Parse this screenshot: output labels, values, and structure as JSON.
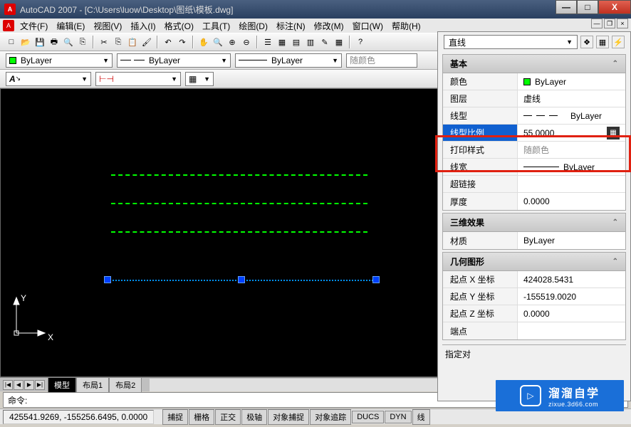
{
  "title": "AutoCAD 2007 - [C:\\Users\\luow\\Desktop\\图纸\\模板.dwg]",
  "menu": [
    "文件(F)",
    "编辑(E)",
    "视图(V)",
    "插入(I)",
    "格式(O)",
    "工具(T)",
    "绘图(D)",
    "标注(N)",
    "修改(M)",
    "窗口(W)",
    "帮助(H)"
  ],
  "layerbar": {
    "bylayer1": "ByLayer",
    "bylayer2": "ByLayer",
    "bylayer3": "ByLayer",
    "color": "随颜色"
  },
  "props": {
    "selector": "直线",
    "sections": {
      "basic": {
        "title": "基本",
        "rows": {
          "color": {
            "label": "颜色",
            "value": "ByLayer"
          },
          "layer": {
            "label": "图层",
            "value": "虚线"
          },
          "linetype": {
            "label": "线型",
            "value": "ByLayer"
          },
          "ltscale": {
            "label": "线型比例",
            "value": "55.0000"
          },
          "plotstyle": {
            "label": "打印样式",
            "value": "随颜色"
          },
          "lineweight": {
            "label": "线宽",
            "value": "ByLayer"
          },
          "hyperlink": {
            "label": "超链接",
            "value": ""
          },
          "thickness": {
            "label": "厚度",
            "value": "0.0000"
          }
        }
      },
      "threed": {
        "title": "三维效果",
        "rows": {
          "material": {
            "label": "材质",
            "value": "ByLayer"
          }
        }
      },
      "geometry": {
        "title": "几何图形",
        "rows": {
          "startx": {
            "label": "起点 X 坐标",
            "value": "424028.5431"
          },
          "starty": {
            "label": "起点 Y 坐标",
            "value": "-155519.0020"
          },
          "startz": {
            "label": "起点 Z 坐标",
            "value": "0.0000"
          },
          "endx": {
            "label": "端点",
            "value": ""
          }
        }
      }
    },
    "footer": "指定对"
  },
  "tabs": {
    "model": "模型",
    "layout1": "布局1",
    "layout2": "布局2"
  },
  "command": {
    "prompt": "命令:"
  },
  "status": {
    "coords": "425541.9269, -155256.6495, 0.0000",
    "toggles": [
      "捕捉",
      "栅格",
      "正交",
      "极轴",
      "对象捕捉",
      "对象追踪",
      "DUCS",
      "DYN",
      "线"
    ]
  },
  "ucs": {
    "x": "X",
    "y": "Y"
  },
  "watermark": {
    "main": "溜溜自学",
    "sub": "zixue.3d66.com"
  },
  "window_controls": {
    "min": "—",
    "max": "□",
    "close": "X"
  },
  "stylebar": {
    "item1": "A",
    "item2": "",
    "item3": ""
  }
}
